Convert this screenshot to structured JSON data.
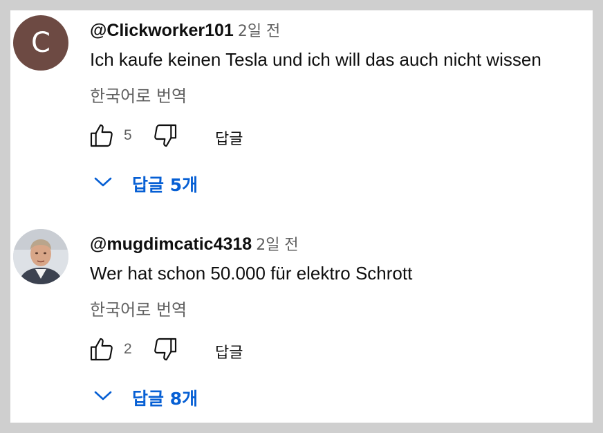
{
  "comments": [
    {
      "author": "@Clickworker101",
      "avatar_letter": "C",
      "time": "2일 전",
      "text": "Ich kaufe keinen Tesla und ich will das auch nicht wissen",
      "translate": "한국어로 번역",
      "likes": "5",
      "reply_label": "답글",
      "replies_label": "답글 5개"
    },
    {
      "author": "@mugdimcatic4318",
      "time": "2일 전",
      "text": "Wer hat schon 50.000 für elektro Schrott",
      "translate": "한국어로 번역",
      "likes": "2",
      "reply_label": "답글",
      "replies_label": "답글 8개"
    }
  ],
  "colors": {
    "accent": "#065fd4",
    "avatar_bg": "#6d4a43",
    "secondary_text": "#606060"
  }
}
